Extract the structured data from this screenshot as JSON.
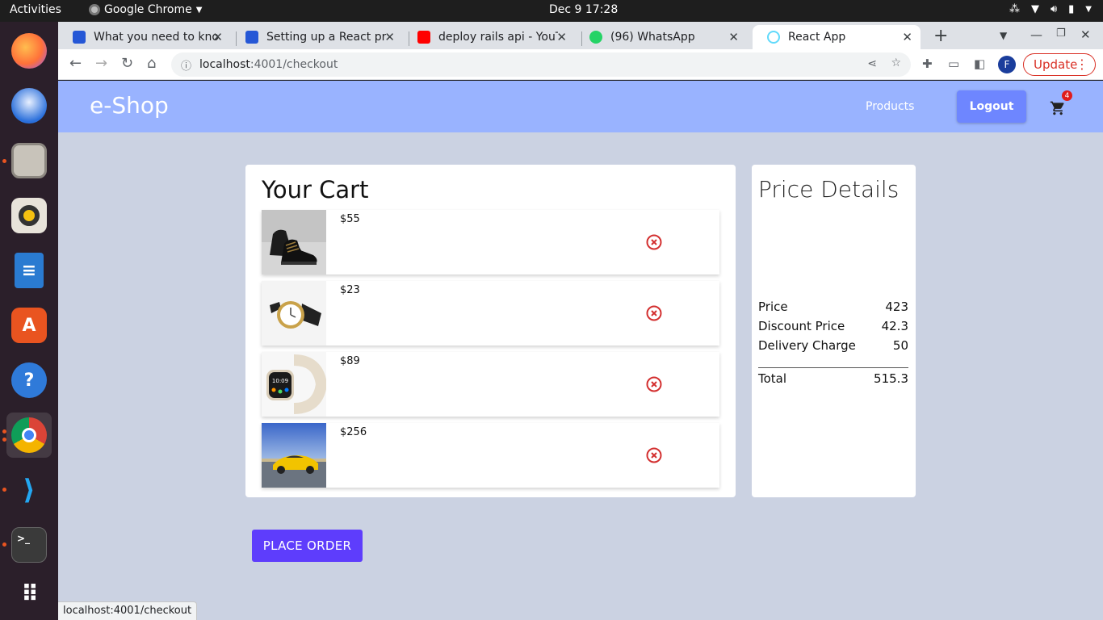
{
  "system": {
    "activities": "Activities",
    "app_name": "Google Chrome",
    "clock": "Dec 9  17:28"
  },
  "tabs": [
    {
      "title": "What you need to kno",
      "favicon": "video-icon",
      "color": "#2557d6"
    },
    {
      "title": "Setting up a React pro",
      "favicon": "video-icon",
      "color": "#2557d6"
    },
    {
      "title": "deploy rails api - YouTu",
      "favicon": "youtube-icon",
      "color": "#ff0000"
    },
    {
      "title": "(96) WhatsApp",
      "favicon": "whatsapp-icon",
      "color": "#25d366"
    },
    {
      "title": "React App",
      "favicon": "react-icon",
      "color": "#61dafb",
      "active": true
    }
  ],
  "omnibox": {
    "host": "localhost",
    "path": ":4001/checkout"
  },
  "profile_initial": "F",
  "update_label": "Update",
  "app": {
    "brand": "e-Shop",
    "nav_products": "Products",
    "logout": "Logout",
    "cart_count": "4",
    "cart_title": "Your Cart",
    "items": [
      {
        "price": "$55",
        "image": "sneakers"
      },
      {
        "price": "$23",
        "image": "watch"
      },
      {
        "price": "$89",
        "image": "smartwatch"
      },
      {
        "price": "$256",
        "image": "sports-car"
      }
    ],
    "price_details": {
      "title": "Price Details",
      "rows": [
        {
          "label": "Price",
          "value": "423"
        },
        {
          "label": "Discount Price",
          "value": "42.3"
        },
        {
          "label": "Delivery Charge",
          "value": "50"
        }
      ],
      "total_label": "Total",
      "total_value": "515.3"
    },
    "place_order": "PLACE ORDER"
  },
  "status_url": "localhost:4001/checkout",
  "colors": {
    "header": "#99b3ff",
    "page_bg": "#cbd2e2",
    "button": "#6e86ff",
    "place_order": "#5e3dfc",
    "remove_icon": "#d32f2f"
  }
}
